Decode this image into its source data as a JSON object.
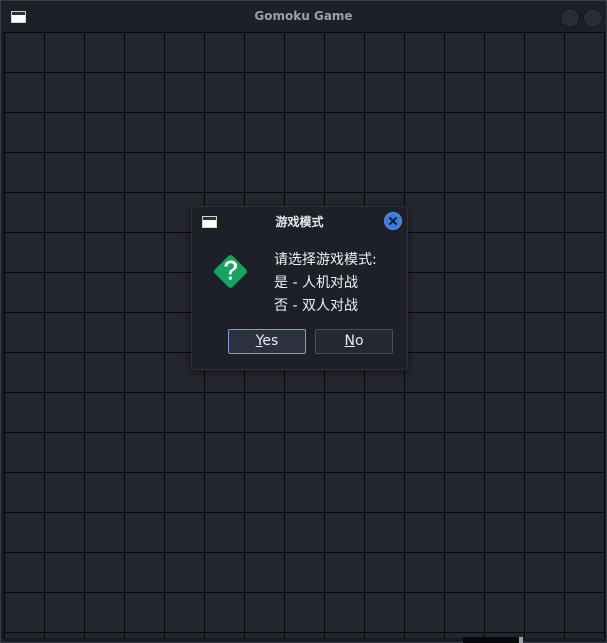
{
  "window": {
    "title": "Gomoku Game",
    "icon": "window-icon",
    "buttons": [
      "minimize-button",
      "close-button"
    ]
  },
  "board": {
    "line_color": "#07080b",
    "cell_color": "#24262d"
  },
  "dialog": {
    "title": "游戏模式",
    "icon": "question-icon",
    "icon_color": "#1aa260",
    "close_color": "#3d7be0",
    "message_lines": [
      "请选择游戏模式:",
      "是 - 人机对战",
      "否 - 双人对战"
    ],
    "yes_button": {
      "mnemonic": "Y",
      "rest": "es"
    },
    "no_button": {
      "mnemonic": "N",
      "rest": "o"
    }
  }
}
